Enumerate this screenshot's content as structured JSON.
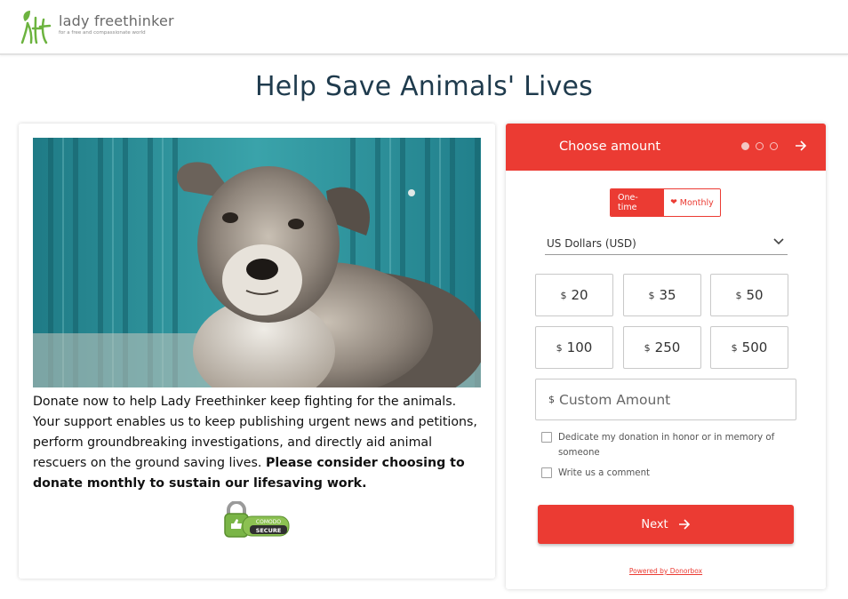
{
  "brand": {
    "name": "lady freethinker",
    "tagline": "for a free and compassionate world",
    "logo_letters": "Lft",
    "logo_color": "#6cb33f"
  },
  "page": {
    "title": "Help Save Animals' Lives"
  },
  "campaign": {
    "hero_image": "puppy-photo",
    "intro_text": "Donate now to help Lady Freethinker keep fighting for the animals. Your support enables us to keep publishing urgent news and petitions, perform groundbreaking investigations, and directly aid animal rescuers on the ground saving lives. ",
    "intro_bold": "Please consider choosing to donate monthly to sustain our lifesaving work.",
    "secure_badge": {
      "top": "COMODO",
      "bottom": "SECURE"
    }
  },
  "donation_form": {
    "accent_color": "#eb3b33",
    "step_title": "Choose amount",
    "steps": {
      "total": 3,
      "current": 1
    },
    "frequency": {
      "one_time": "One-time",
      "monthly": "Monthly",
      "selected": "one_time"
    },
    "currency": "US Dollars (USD)",
    "currency_symbol": "$",
    "amounts": [
      "20",
      "35",
      "50",
      "100",
      "250",
      "500"
    ],
    "custom_amount_placeholder": "Custom Amount",
    "dedicate_label": "Dedicate my donation in honor or in memory of someone",
    "comment_label": "Write us a comment",
    "next_label": "Next",
    "powered_by": "Powered by Donorbox"
  }
}
